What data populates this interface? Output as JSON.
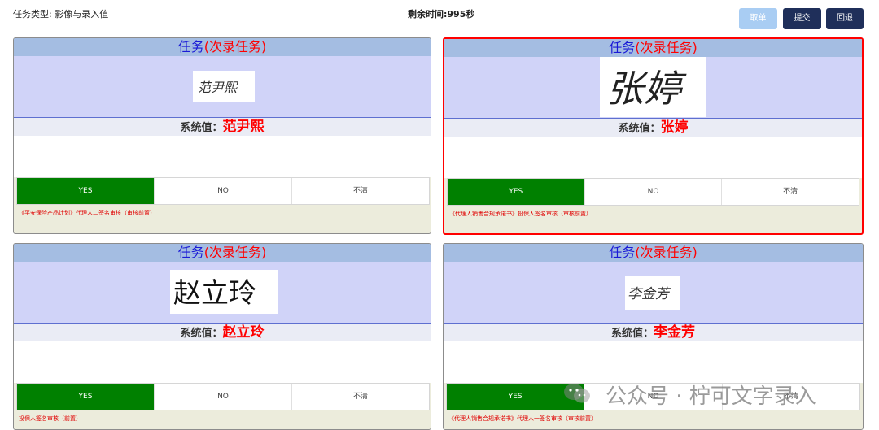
{
  "header": {
    "task_type": "任务类型: 影像与录入值",
    "timer": "剩余时间:995秒",
    "cancel_label": "取单",
    "submit_label": "提交",
    "back_label": "回退"
  },
  "cards": [
    {
      "title": "任务",
      "title_sub": "(次录任务)",
      "sys_label": "系统值：",
      "sys_value": "范尹熙",
      "signature_text": "范尹熙",
      "yes": "YES",
      "no": "NO",
      "unclear": "不清",
      "note": "《平安保险产品计划》代理人二签名审核（审核前置）"
    },
    {
      "title": "任务",
      "title_sub": "(次录任务)",
      "sys_label": "系统值：",
      "sys_value": "张婷",
      "signature_text": "张婷",
      "yes": "YES",
      "no": "NO",
      "unclear": "不清",
      "note": "《代理人销售合规承诺书》投保人签名审核（审核前置）"
    },
    {
      "title": "任务",
      "title_sub": "(次录任务)",
      "sys_label": "系统值：",
      "sys_value": "赵立玲",
      "signature_text": "赵立玲",
      "yes": "YES",
      "no": "NO",
      "unclear": "不清",
      "note": "投保人签名审核（前置）"
    },
    {
      "title": "任务",
      "title_sub": "(次录任务)",
      "sys_label": "系统值：",
      "sys_value": "李金芳",
      "signature_text": "李金芳",
      "yes": "YES",
      "no": "NO",
      "unclear": "不清",
      "note": "《代理人销售合规承诺书》代理人一签名审核（审核前置）"
    }
  ],
  "watermark": "公众号 · 柠可文字录入",
  "colors": {
    "selected_border": "#ff0000",
    "yes_green": "#008000",
    "header_blue": "#a4bde2",
    "image_bg": "#d0d3f8",
    "dark_button": "#1f2f5a",
    "light_button": "#a9cdf3"
  }
}
